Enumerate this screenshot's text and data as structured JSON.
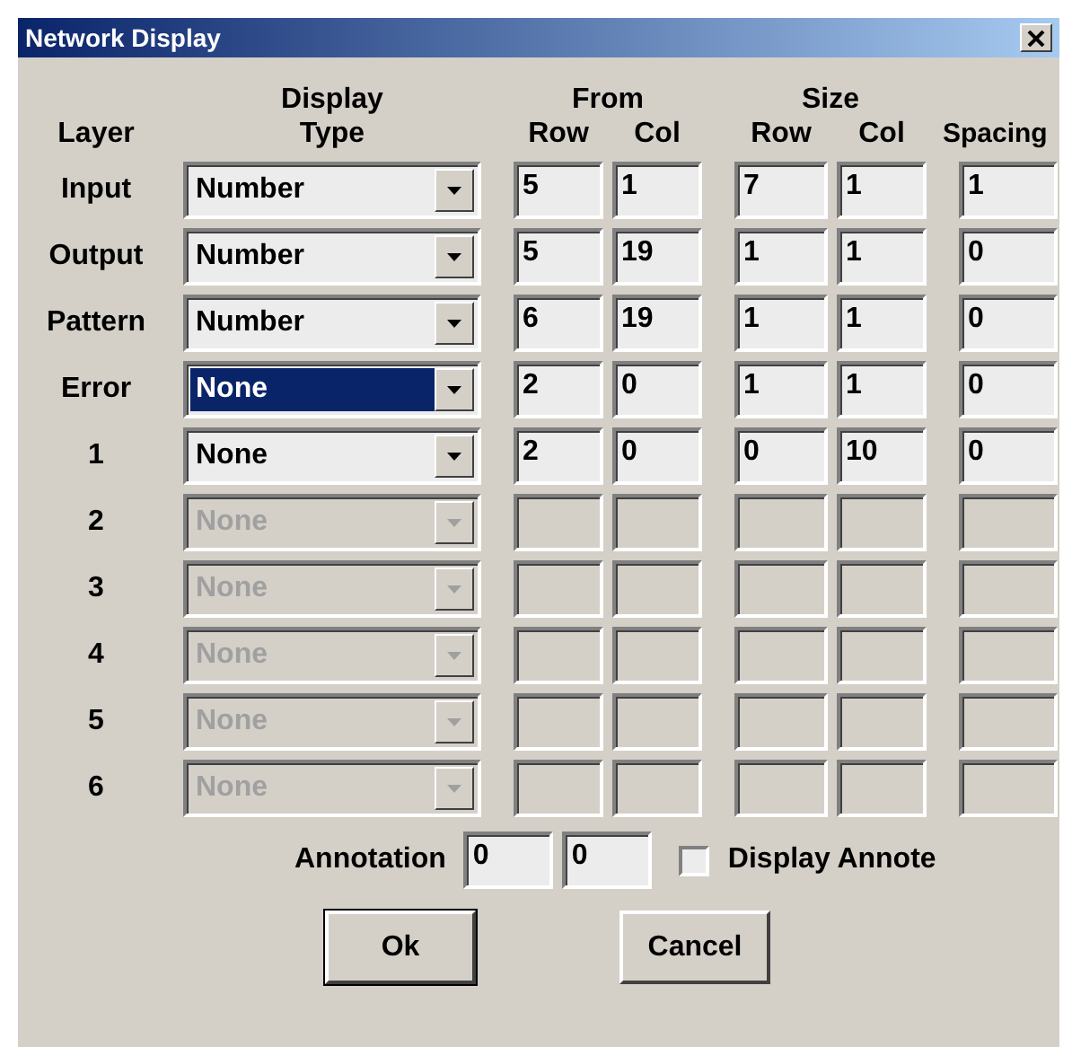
{
  "window": {
    "title": "Network Display"
  },
  "headers": {
    "layer": "Layer",
    "display_type": [
      "Display",
      "Type"
    ],
    "from": "From",
    "from_row": "Row",
    "from_col": "Col",
    "size": "Size",
    "size_row": "Row",
    "size_col": "Col",
    "spacing": "Spacing"
  },
  "rows": [
    {
      "layer": "Input",
      "display_type": {
        "value": "Number",
        "disabled": false,
        "selected": false
      },
      "from_row": "5",
      "from_col": "1",
      "size_row": "7",
      "size_col": "1",
      "spacing": "1",
      "disabled": false
    },
    {
      "layer": "Output",
      "display_type": {
        "value": "Number",
        "disabled": false,
        "selected": false
      },
      "from_row": "5",
      "from_col": "19",
      "size_row": "1",
      "size_col": "1",
      "spacing": "0",
      "disabled": false
    },
    {
      "layer": "Pattern",
      "display_type": {
        "value": "Number",
        "disabled": false,
        "selected": false
      },
      "from_row": "6",
      "from_col": "19",
      "size_row": "1",
      "size_col": "1",
      "spacing": "0",
      "disabled": false
    },
    {
      "layer": "Error",
      "display_type": {
        "value": "None",
        "disabled": false,
        "selected": true
      },
      "from_row": "2",
      "from_col": "0",
      "size_row": "1",
      "size_col": "1",
      "spacing": "0",
      "disabled": false
    },
    {
      "layer": "1",
      "display_type": {
        "value": "None",
        "disabled": false,
        "selected": false
      },
      "from_row": "2",
      "from_col": "0",
      "size_row": "0",
      "size_col": "10",
      "spacing": "0",
      "disabled": false
    },
    {
      "layer": "2",
      "display_type": {
        "value": "None",
        "disabled": true,
        "selected": false
      },
      "disabled": true
    },
    {
      "layer": "3",
      "display_type": {
        "value": "None",
        "disabled": true,
        "selected": false
      },
      "disabled": true
    },
    {
      "layer": "4",
      "display_type": {
        "value": "None",
        "disabled": true,
        "selected": false
      },
      "disabled": true
    },
    {
      "layer": "5",
      "display_type": {
        "value": "None",
        "disabled": true,
        "selected": false
      },
      "disabled": true
    },
    {
      "layer": "6",
      "display_type": {
        "value": "None",
        "disabled": true,
        "selected": false
      },
      "disabled": true
    }
  ],
  "annotation": {
    "label": "Annotation",
    "values": [
      "0",
      "0"
    ],
    "checkbox": {
      "label": "Display Annote",
      "checked": false
    }
  },
  "buttons": [
    {
      "label": "Ok",
      "default": true
    },
    {
      "label": "Cancel",
      "default": false
    }
  ]
}
